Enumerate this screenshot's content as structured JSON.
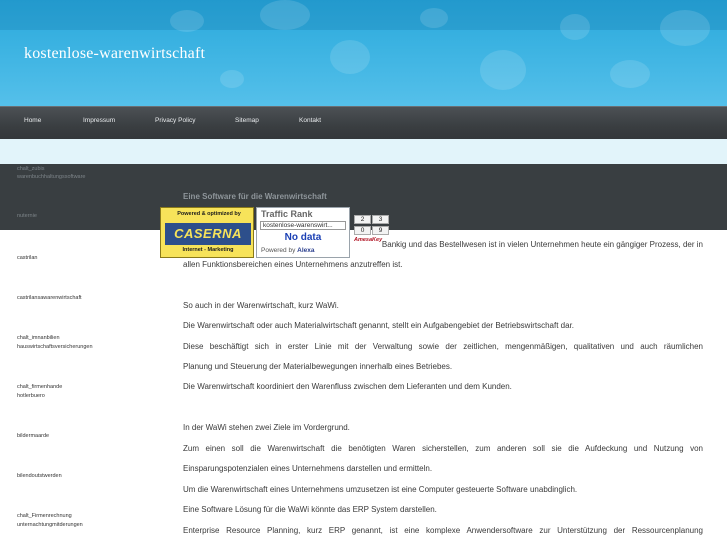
{
  "header": {
    "title": "kostenlose-warenwirtschaft"
  },
  "nav": {
    "items": [
      {
        "label": "Home"
      },
      {
        "label": "Impressum"
      },
      {
        "label": "Privacy Policy"
      },
      {
        "label": "Sitemap"
      },
      {
        "label": "Kontakt"
      }
    ]
  },
  "sidebar": {
    "items": [
      {
        "label": "chalt_zubis"
      },
      {
        "label": "warenbuchhaltungssoftware"
      },
      {
        "label": "nuternie"
      },
      {
        "label": "castrilan"
      },
      {
        "label": "castrilansawarenwirtschaft"
      },
      {
        "label": "chalt_imnanbilien"
      },
      {
        "label": "hauswirtschaftsversicherungen"
      },
      {
        "label": "chalt_firmenhande"
      },
      {
        "label": "hotlerbuero"
      },
      {
        "label": "bildermaarde"
      },
      {
        "label": "bilendoutstwerden"
      },
      {
        "label": "chalt_Firmenrechnung"
      },
      {
        "label": "unternachtungmitderungen"
      }
    ]
  },
  "widget": {
    "badge_top": "Powered & optimized by",
    "badge_logo": "CASERNA",
    "badge_bottom": "Internet - Marketing",
    "rank_title": "Traffic Rank",
    "rank_domain": "kostenlose-warenswirt...",
    "rank_value": "No data",
    "powered_prefix": "Powered by",
    "powered_brand": "Alexa",
    "digits": [
      "2",
      "3",
      "0",
      "9"
    ],
    "akey": "AmesaKey"
  },
  "content": {
    "heading": "Eine Software für die Warenwirtschaft",
    "line1_tail": "Bankig und das Bestellwesen ist in vielen Unternehmen heute ein gängiger Prozess, der in",
    "line2": "allen Funktionsbereichen eines Unternehmens anzutreffen ist.",
    "p1": "So auch in der Warenwirtschaft, kurz WaWi.",
    "p2": "Die Warenwirtschaft oder auch Materialwirtschaft genannt, stellt ein Aufgabengebiet der Betriebswirtschaft dar.",
    "p3": "Diese beschäftigt sich in erster Linie mit der Verwaltung sowie der zeitlichen, mengenmäßigen, qualitativen und auch räumlichen",
    "p4": "Planung und Steuerung der Materialbewegungen innerhalb eines Betriebes.",
    "p5": "Die Warenwirtschaft koordiniert den Warenfluss zwischen dem Lieferanten und dem Kunden.",
    "p6": "In der WaWi stehen zwei Ziele im Vordergrund.",
    "p7": "Zum einen soll die Warenwirtschaft die benötigten Waren sicherstellen, zum anderen soll sie die Aufdeckung und Nutzung von",
    "p8": "Einsparungspotenzialen eines Unternehmens darstellen und ermitteln.",
    "p9": "Um die Warenwirtschaft eines Unternehmens umzusetzen ist eine Computer gesteuerte Software unabdinglich.",
    "p10": "Eine Software Lösung für die WaWi könnte das ERP System darstellen.",
    "p11": "Enterprise Resource Planning, kurz ERP genannt, ist eine komplexe Anwendersoftware zur Unterstützung der Ressourcenplanung"
  }
}
